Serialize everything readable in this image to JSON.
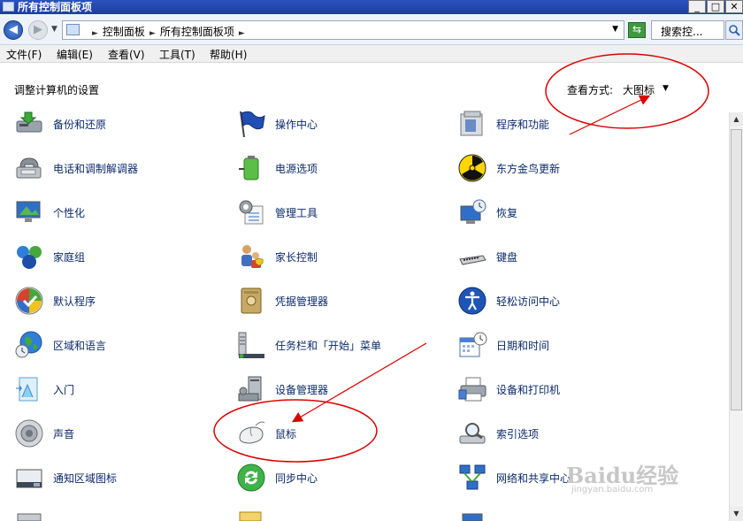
{
  "window": {
    "title": "所有控制面板项"
  },
  "address": {
    "crumbs": [
      "控制面板",
      "所有控制面板项"
    ],
    "search_placeholder": "搜索控..."
  },
  "menu": [
    "文件(F)",
    "编辑(E)",
    "查看(V)",
    "工具(T)",
    "帮助(H)"
  ],
  "main": {
    "heading": "调整计算机的设置",
    "view_label": "查看方式:",
    "view_value": "大图标"
  },
  "items": [
    {
      "label": "备份和还原",
      "icon": "backup-icon"
    },
    {
      "label": "操作中心",
      "icon": "action-center-flag-icon"
    },
    {
      "label": "程序和功能",
      "icon": "programs-icon"
    },
    {
      "label": "电话和调制解调器",
      "icon": "phone-modem-icon"
    },
    {
      "label": "电源选项",
      "icon": "power-battery-icon"
    },
    {
      "label": "东方金鸟更新",
      "icon": "radiation-update-icon"
    },
    {
      "label": "个性化",
      "icon": "personalization-icon"
    },
    {
      "label": "管理工具",
      "icon": "admin-tools-gear-icon"
    },
    {
      "label": "恢复",
      "icon": "recovery-icon"
    },
    {
      "label": "家庭组",
      "icon": "homegroup-icon"
    },
    {
      "label": "家长控制",
      "icon": "parental-controls-icon"
    },
    {
      "label": "键盘",
      "icon": "keyboard-icon"
    },
    {
      "label": "默认程序",
      "icon": "default-programs-icon"
    },
    {
      "label": "凭据管理器",
      "icon": "credential-vault-icon"
    },
    {
      "label": "轻松访问中心",
      "icon": "ease-of-access-icon"
    },
    {
      "label": "区域和语言",
      "icon": "region-globe-icon"
    },
    {
      "label": "任务栏和「开始」菜单",
      "icon": "taskbar-start-icon"
    },
    {
      "label": "日期和时间",
      "icon": "calendar-clock-icon"
    },
    {
      "label": "入门",
      "icon": "getting-started-icon"
    },
    {
      "label": "设备管理器",
      "icon": "device-manager-icon"
    },
    {
      "label": "设备和打印机",
      "icon": "printer-icon"
    },
    {
      "label": "声音",
      "icon": "speaker-icon"
    },
    {
      "label": "鼠标",
      "icon": "mouse-icon"
    },
    {
      "label": "索引选项",
      "icon": "indexing-magnifier-icon"
    },
    {
      "label": "通知区域图标",
      "icon": "notification-area-icon"
    },
    {
      "label": "同步中心",
      "icon": "sync-center-icon"
    },
    {
      "label": "网络和共享中心",
      "icon": "network-sharing-icon"
    }
  ],
  "watermark": {
    "brand": "Baidu经验",
    "url": "jingyan.baidu.com"
  }
}
